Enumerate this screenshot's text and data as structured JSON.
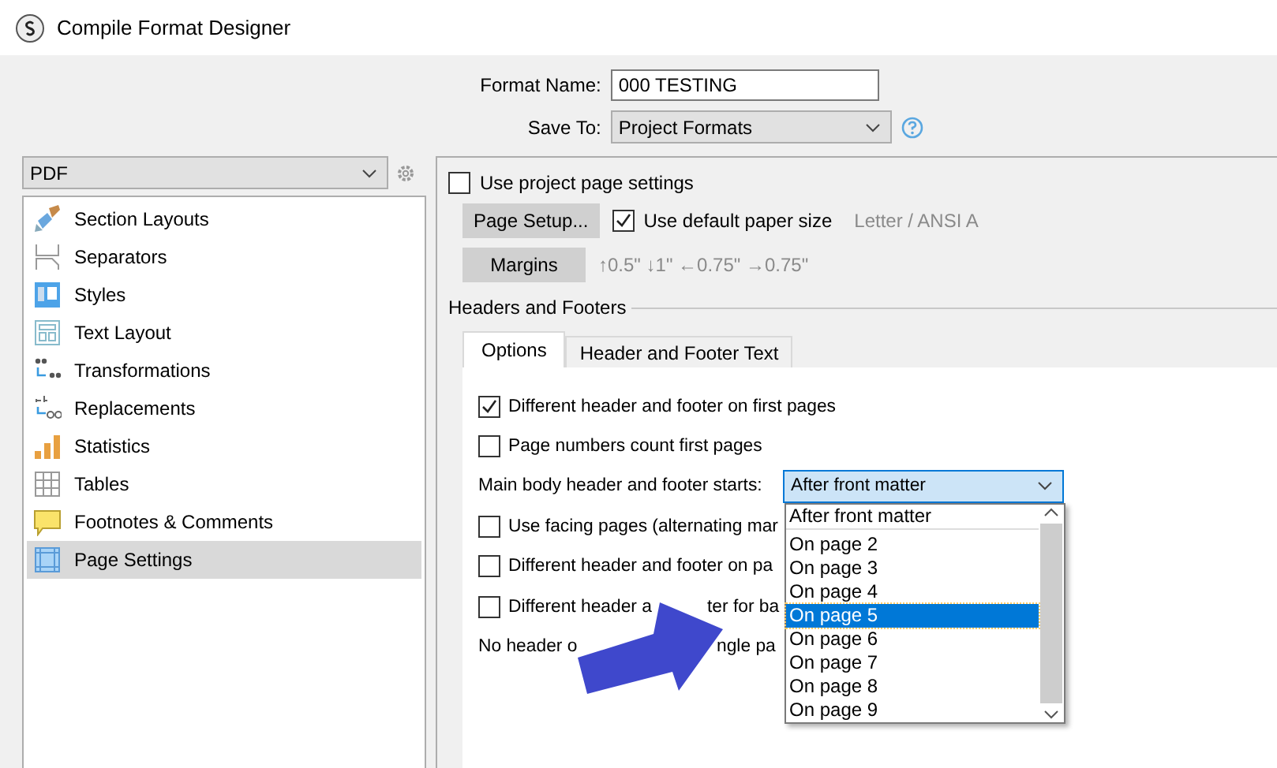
{
  "window": {
    "title": "Compile Format Designer"
  },
  "format_name": {
    "label": "Format Name:",
    "value": "000 TESTING"
  },
  "save_to": {
    "label": "Save To:",
    "value": "Project Formats"
  },
  "format_select": {
    "value": "PDF"
  },
  "sidebar": {
    "items": [
      {
        "label": "Section Layouts",
        "selected": false
      },
      {
        "label": "Separators",
        "selected": false
      },
      {
        "label": "Styles",
        "selected": false
      },
      {
        "label": "Text Layout",
        "selected": false
      },
      {
        "label": "Transformations",
        "selected": false
      },
      {
        "label": "Replacements",
        "selected": false
      },
      {
        "label": "Statistics",
        "selected": false
      },
      {
        "label": "Tables",
        "selected": false
      },
      {
        "label": "Footnotes & Comments",
        "selected": false
      },
      {
        "label": "Page Settings",
        "selected": true
      }
    ]
  },
  "page_settings": {
    "use_project": {
      "label": "Use project page settings",
      "checked": false
    },
    "page_setup_button": "Page Setup...",
    "default_paper": {
      "label": "Use default paper size",
      "checked": true
    },
    "paper_size": "Letter / ANSI A",
    "margins_button": "Margins",
    "margins": "↑0.5\" ↓1\" ←0.75\" →0.75\""
  },
  "headers_footers": {
    "title": "Headers and Footers",
    "tabs": [
      {
        "label": "Options",
        "selected": true
      },
      {
        "label": "Header and Footer Text",
        "selected": false
      }
    ],
    "rows": [
      {
        "kind": "checkbox",
        "label": "Different header and footer on first pages",
        "checked": true
      },
      {
        "kind": "checkbox",
        "label": "Page numbers count first pages",
        "checked": false
      },
      {
        "kind": "select",
        "label": "Main body header and footer starts:",
        "value": "After front matter",
        "options": [
          {
            "label": "After front matter",
            "highlighted": false
          },
          {
            "label": "On page 2",
            "highlighted": false
          },
          {
            "label": "On page 3",
            "highlighted": false
          },
          {
            "label": "On page 4",
            "highlighted": false
          },
          {
            "label": "On page 5",
            "highlighted": true
          },
          {
            "label": "On page 6",
            "highlighted": false
          },
          {
            "label": "On page 7",
            "highlighted": false
          },
          {
            "label": "On page 8",
            "highlighted": false
          },
          {
            "label": "On page 9",
            "highlighted": false
          }
        ]
      },
      {
        "kind": "checkbox",
        "label": "Use facing pages (alternating mar",
        "checked": false
      },
      {
        "kind": "checkbox",
        "label": "Different header and footer on pa",
        "checked": false
      },
      {
        "kind": "checkbox",
        "label": "Different header a",
        "label_after": "ter for ba",
        "checked": false
      },
      {
        "kind": "note",
        "label": "No header o",
        "label_after": "ngle pa"
      }
    ]
  }
}
